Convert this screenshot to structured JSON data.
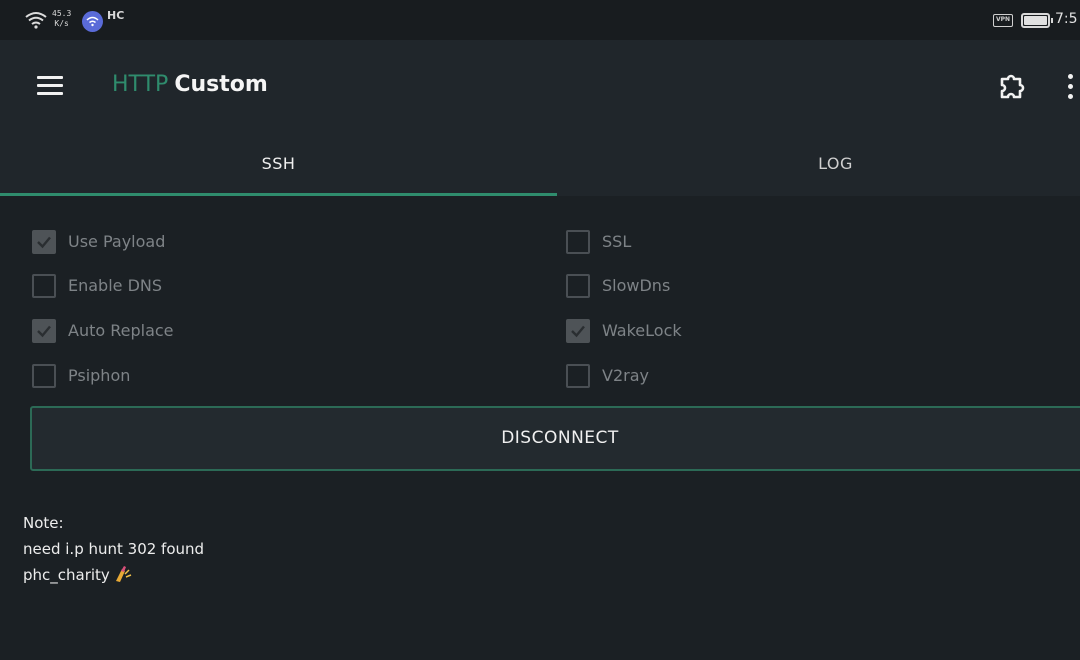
{
  "status_bar": {
    "speed_value": "45.3",
    "speed_unit": "K/s",
    "hc_label": "HC",
    "vpn_label": "VPN",
    "time": "7:5"
  },
  "app_bar": {
    "title_part1": "HTTP",
    "title_part2": "Custom"
  },
  "tabs": [
    {
      "label": "SSH",
      "selected": true
    },
    {
      "label": "LOG",
      "selected": false
    }
  ],
  "options": [
    {
      "label": "Use Payload",
      "checked": true
    },
    {
      "label": "SSL",
      "checked": false
    },
    {
      "label": "Enable DNS",
      "checked": false
    },
    {
      "label": "SlowDns",
      "checked": false
    },
    {
      "label": "Auto Replace",
      "checked": true
    },
    {
      "label": "WakeLock",
      "checked": true
    },
    {
      "label": "Psiphon",
      "checked": false
    },
    {
      "label": "V2ray",
      "checked": false
    }
  ],
  "action": {
    "label": "DISCONNECT"
  },
  "note": {
    "heading": "Note:",
    "line1": "need i.p hunt 302 found",
    "line2": "phc_charity"
  },
  "colors": {
    "accent": "#2f8c6d",
    "background": "#1b2024",
    "toolbar": "#20262b",
    "checkbox_checked": "#4e5357",
    "label_disabled": "#7e8387"
  }
}
